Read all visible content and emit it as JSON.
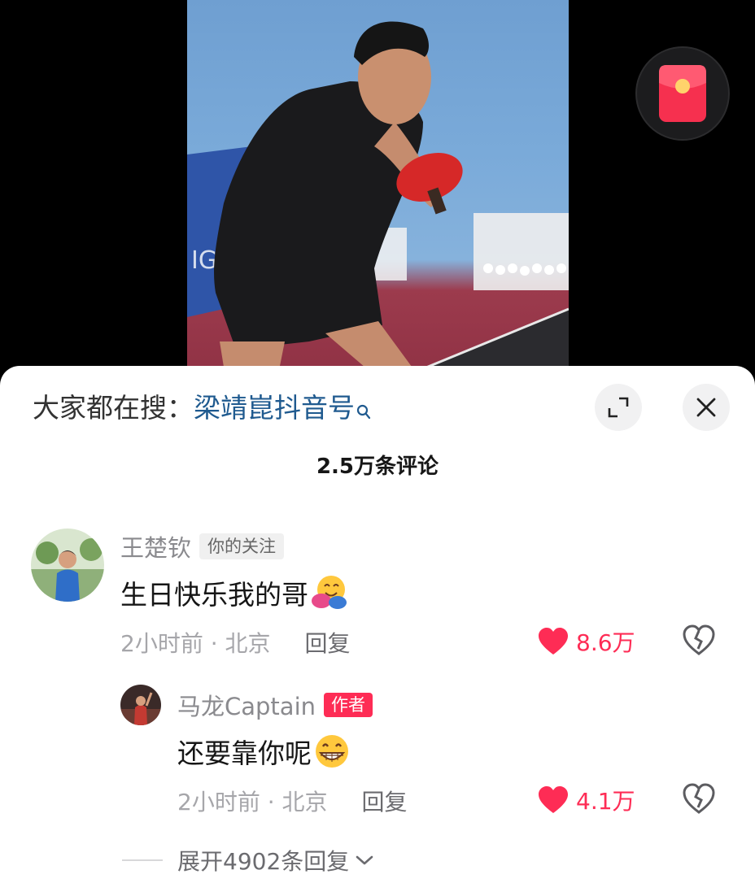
{
  "search": {
    "prefix": "大家都在搜：",
    "term": "梁靖崑抖音号"
  },
  "comment_count": "2.5万条评论",
  "comments": [
    {
      "username": "王楚钦",
      "badge": "你的关注",
      "text": "生日快乐我的哥",
      "emoji": "hugging-face",
      "time_location": "2小时前 · 北京",
      "reply_label": "回复",
      "likes": "8.6万"
    }
  ],
  "reply": {
    "username": "马龙Captain",
    "badge": "作者",
    "text": "还要靠你呢",
    "emoji": "grinning-face",
    "time_location": "2小时前 · 北京",
    "reply_label": "回复",
    "likes": "4.1万"
  },
  "expand_replies": "展开4902条回复",
  "colors": {
    "accent_red": "#fe2c55",
    "link_blue": "#1f5a8f",
    "muted_text": "#8a8a8e"
  },
  "icons": [
    "red-packet-icon",
    "search-icon",
    "expand-icon",
    "close-icon",
    "heart-icon",
    "dislike-icon",
    "chevron-down-icon"
  ]
}
